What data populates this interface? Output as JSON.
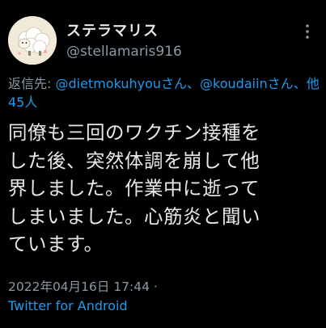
{
  "author": {
    "display_name": "ステラマリス",
    "handle": "@stellamaris916"
  },
  "reply": {
    "prefix": "返信先: ",
    "mention_1": "@dietmokuhyou",
    "sep_1": "さん、",
    "mention_2": "@koudaiin",
    "sep_2": "さん、",
    "others": "他45人"
  },
  "tweet": {
    "text": "同僚も三回のワクチン接種を\nした後、突然体調を崩して他\n界しました。作業中に逝って\nしまいました。心筋炎と聞い\nています。"
  },
  "meta": {
    "timestamp": "2022年04月16日 17:44 ·",
    "source": "Twitter for Android"
  },
  "icons": {
    "more": "more-options-icon",
    "avatar": "sheep-avatar"
  },
  "colors": {
    "background": "#000000",
    "text": "#e7e9ea",
    "secondary": "#8b98a5",
    "accent": "#1d9bf0"
  }
}
